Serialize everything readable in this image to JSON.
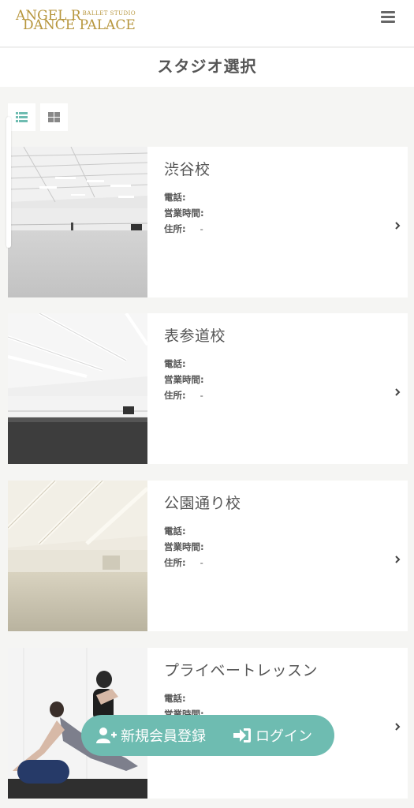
{
  "header": {
    "logo_line1": "ANGEL R",
    "logo_studio": "BALLET STUDIO",
    "logo_line2": "DANCE PALACE",
    "brand_color": "#b7963d",
    "menu_icon": "hamburger-menu-icon"
  },
  "page": {
    "title": "スタジオ選択"
  },
  "view_toggle": {
    "list_icon": "list-view-icon",
    "grid_icon": "grid-view-icon",
    "active": "list",
    "accent": "#6ebcb1"
  },
  "labels": {
    "phone": "電話:",
    "hours": "営業時間:",
    "address": "住所:"
  },
  "studios": [
    {
      "name": "渋谷校",
      "phone": "",
      "hours": "",
      "address": "-"
    },
    {
      "name": "表参道校",
      "phone": "",
      "hours": "",
      "address": "-"
    },
    {
      "name": "公園通り校",
      "phone": "",
      "hours": "",
      "address": "-"
    },
    {
      "name": "プライベートレッスン",
      "phone": "",
      "hours": "",
      "address": ""
    }
  ],
  "cta": {
    "register_label": "新規会員登録",
    "register_icon": "user-plus-icon",
    "login_label": "ログイン",
    "login_icon": "sign-in-icon",
    "color": "#6ebcb1"
  }
}
